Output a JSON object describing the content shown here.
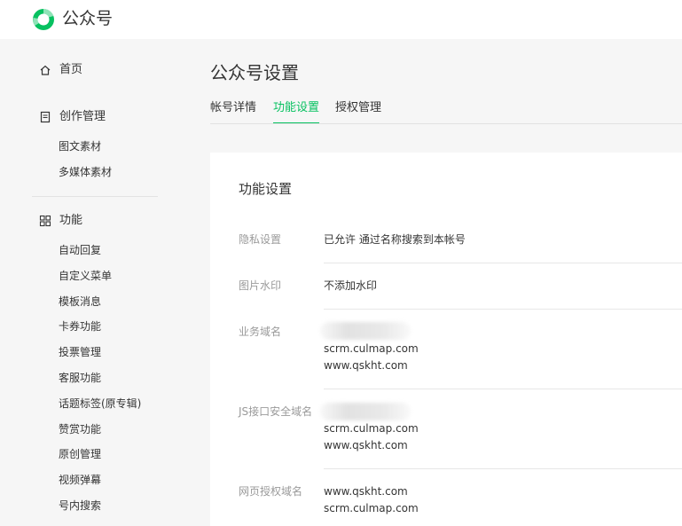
{
  "header": {
    "brand": "公众号"
  },
  "sidebar": {
    "home": "首页",
    "creation": {
      "label": "创作管理",
      "items": [
        "图文素材",
        "多媒体素材"
      ]
    },
    "features": {
      "label": "功能",
      "items": [
        "自动回复",
        "自定义菜单",
        "模板消息",
        "卡券功能",
        "投票管理",
        "客服功能",
        "话题标签(原专辑)",
        "赞赏功能",
        "原创管理",
        "视频弹幕",
        "号内搜索"
      ]
    }
  },
  "main": {
    "title": "公众号设置",
    "tabs": [
      {
        "label": "帐号详情",
        "active": false
      },
      {
        "label": "功能设置",
        "active": true
      },
      {
        "label": "授权管理",
        "active": false
      }
    ],
    "section_title": "功能设置",
    "rows": [
      {
        "label": "隐私设置",
        "values": [
          "已允许 通过名称搜索到本帐号"
        ]
      },
      {
        "label": "图片水印",
        "values": [
          "不添加水印"
        ]
      },
      {
        "label": "业务域名",
        "values": [
          "scrm.culmap.com",
          "www.qskht.com"
        ]
      },
      {
        "label": "JS接口安全域名",
        "values": [
          "scrm.culmap.com",
          "www.qskht.com"
        ]
      },
      {
        "label": "网页授权域名",
        "values": [
          "www.qskht.com",
          "scrm.culmap.com"
        ]
      }
    ]
  },
  "colors": {
    "accent": "#07c160",
    "text": "#353535",
    "muted": "#9a9a9a",
    "background": "#f6f6f6",
    "card": "#ffffff"
  },
  "icons": {
    "logo": "wechat-logo-icon",
    "home": "home-icon",
    "creation": "document-icon",
    "features": "grid-icon"
  }
}
